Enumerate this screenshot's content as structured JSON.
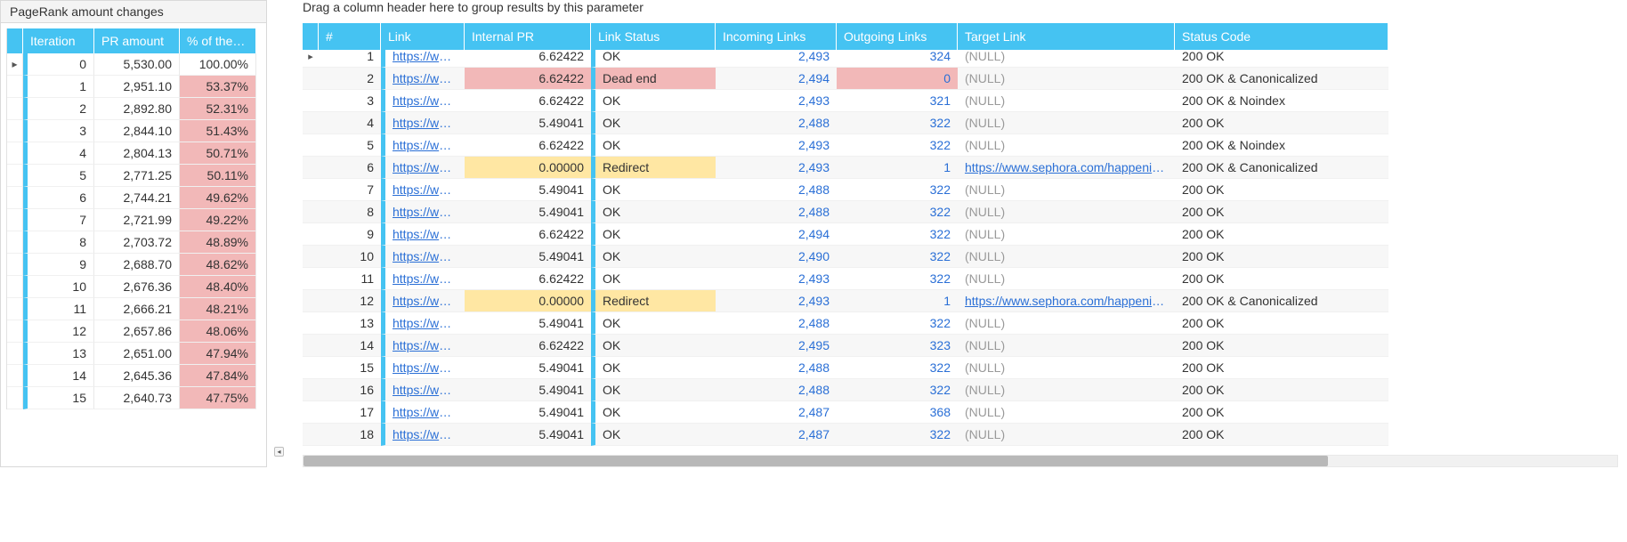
{
  "left": {
    "title": "PageRank amount changes",
    "columns": {
      "iter": "Iteration",
      "pr": "PR amount",
      "pct": "% of the I..."
    },
    "rows": [
      {
        "iter": "0",
        "pr": "5,530.00",
        "pct": "100.00%",
        "full": true
      },
      {
        "iter": "1",
        "pr": "2,951.10",
        "pct": "53.37%"
      },
      {
        "iter": "2",
        "pr": "2,892.80",
        "pct": "52.31%"
      },
      {
        "iter": "3",
        "pr": "2,844.10",
        "pct": "51.43%"
      },
      {
        "iter": "4",
        "pr": "2,804.13",
        "pct": "50.71%"
      },
      {
        "iter": "5",
        "pr": "2,771.25",
        "pct": "50.11%"
      },
      {
        "iter": "6",
        "pr": "2,744.21",
        "pct": "49.62%"
      },
      {
        "iter": "7",
        "pr": "2,721.99",
        "pct": "49.22%"
      },
      {
        "iter": "8",
        "pr": "2,703.72",
        "pct": "48.89%"
      },
      {
        "iter": "9",
        "pr": "2,688.70",
        "pct": "48.62%"
      },
      {
        "iter": "10",
        "pr": "2,676.36",
        "pct": "48.40%"
      },
      {
        "iter": "11",
        "pr": "2,666.21",
        "pct": "48.21%"
      },
      {
        "iter": "12",
        "pr": "2,657.86",
        "pct": "48.06%"
      },
      {
        "iter": "13",
        "pr": "2,651.00",
        "pct": "47.94%"
      },
      {
        "iter": "14",
        "pr": "2,645.36",
        "pct": "47.84%"
      },
      {
        "iter": "15",
        "pr": "2,640.73",
        "pct": "47.75%"
      }
    ],
    "marker": "▸"
  },
  "right": {
    "groupbar": "Drag a column header here to group results by this parameter",
    "marker": "▸",
    "columns": {
      "num": "#",
      "link": "Link",
      "pr": "Internal PR",
      "status": "Link Status",
      "incoming": "Incoming Links",
      "outgoing": "Outgoing Links",
      "target": "Target Link",
      "code": "Status Code"
    },
    "rows": [
      {
        "n": "1",
        "link": "https://www....",
        "pr": "6.62422",
        "status": "OK",
        "in": "2,493",
        "out": "324",
        "target": "(NULL)",
        "target_null": true,
        "code": "200 OK"
      },
      {
        "n": "2",
        "link": "https://www....",
        "pr": "6.62422",
        "status": "Dead end",
        "in": "2,494",
        "out": "0",
        "target": "(NULL)",
        "target_null": true,
        "code": "200 OK & Canonicalized",
        "pr_red": true,
        "status_red": true,
        "out_red": true
      },
      {
        "n": "3",
        "link": "https://www....",
        "pr": "6.62422",
        "status": "OK",
        "in": "2,493",
        "out": "321",
        "target": "(NULL)",
        "target_null": true,
        "code": "200 OK & Noindex"
      },
      {
        "n": "4",
        "link": "https://www....",
        "pr": "5.49041",
        "status": "OK",
        "in": "2,488",
        "out": "322",
        "target": "(NULL)",
        "target_null": true,
        "code": "200 OK"
      },
      {
        "n": "5",
        "link": "https://www....",
        "pr": "6.62422",
        "status": "OK",
        "in": "2,493",
        "out": "322",
        "target": "(NULL)",
        "target_null": true,
        "code": "200 OK & Noindex"
      },
      {
        "n": "6",
        "link": "https://www....",
        "pr": "0.00000",
        "status": "Redirect",
        "in": "2,493",
        "out": "1",
        "target": "https://www.sephora.com/happenin...",
        "target_null": false,
        "code": "200 OK & Canonicalized",
        "pr_ylw": true,
        "status_ylw": true
      },
      {
        "n": "7",
        "link": "https://www....",
        "pr": "5.49041",
        "status": "OK",
        "in": "2,488",
        "out": "322",
        "target": "(NULL)",
        "target_null": true,
        "code": "200 OK"
      },
      {
        "n": "8",
        "link": "https://www....",
        "pr": "5.49041",
        "status": "OK",
        "in": "2,488",
        "out": "322",
        "target": "(NULL)",
        "target_null": true,
        "code": "200 OK"
      },
      {
        "n": "9",
        "link": "https://www....",
        "pr": "6.62422",
        "status": "OK",
        "in": "2,494",
        "out": "322",
        "target": "(NULL)",
        "target_null": true,
        "code": "200 OK"
      },
      {
        "n": "10",
        "link": "https://www....",
        "pr": "5.49041",
        "status": "OK",
        "in": "2,490",
        "out": "322",
        "target": "(NULL)",
        "target_null": true,
        "code": "200 OK"
      },
      {
        "n": "11",
        "link": "https://www....",
        "pr": "6.62422",
        "status": "OK",
        "in": "2,493",
        "out": "322",
        "target": "(NULL)",
        "target_null": true,
        "code": "200 OK"
      },
      {
        "n": "12",
        "link": "https://www....",
        "pr": "0.00000",
        "status": "Redirect",
        "in": "2,493",
        "out": "1",
        "target": "https://www.sephora.com/happenin...",
        "target_null": false,
        "code": "200 OK & Canonicalized",
        "pr_ylw": true,
        "status_ylw": true
      },
      {
        "n": "13",
        "link": "https://www....",
        "pr": "5.49041",
        "status": "OK",
        "in": "2,488",
        "out": "322",
        "target": "(NULL)",
        "target_null": true,
        "code": "200 OK"
      },
      {
        "n": "14",
        "link": "https://www....",
        "pr": "6.62422",
        "status": "OK",
        "in": "2,495",
        "out": "323",
        "target": "(NULL)",
        "target_null": true,
        "code": "200 OK"
      },
      {
        "n": "15",
        "link": "https://www....",
        "pr": "5.49041",
        "status": "OK",
        "in": "2,488",
        "out": "322",
        "target": "(NULL)",
        "target_null": true,
        "code": "200 OK"
      },
      {
        "n": "16",
        "link": "https://www....",
        "pr": "5.49041",
        "status": "OK",
        "in": "2,488",
        "out": "322",
        "target": "(NULL)",
        "target_null": true,
        "code": "200 OK"
      },
      {
        "n": "17",
        "link": "https://www....",
        "pr": "5.49041",
        "status": "OK",
        "in": "2,487",
        "out": "368",
        "target": "(NULL)",
        "target_null": true,
        "code": "200 OK"
      },
      {
        "n": "18",
        "link": "https://www....",
        "pr": "5.49041",
        "status": "OK",
        "in": "2,487",
        "out": "322",
        "target": "(NULL)",
        "target_null": true,
        "code": "200 OK"
      }
    ]
  },
  "collapse_glyph": "◂"
}
